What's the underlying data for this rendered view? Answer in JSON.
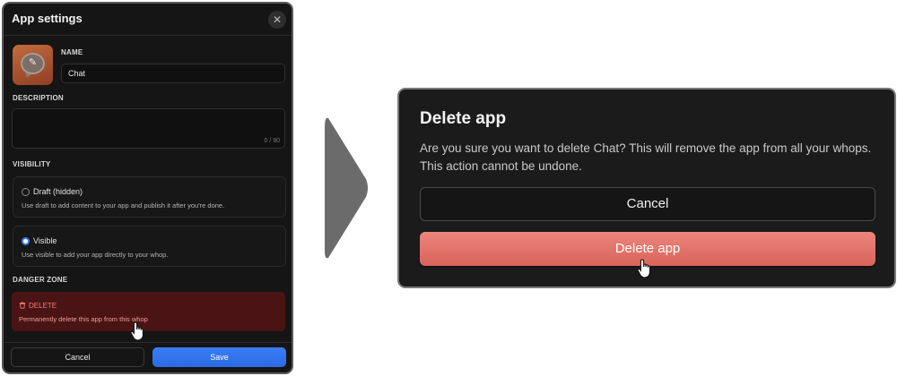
{
  "settings": {
    "title": "App settings",
    "close_glyph": "✕",
    "close_icon": "close-icon",
    "app_icon": "chat-bubble-icon",
    "edit_glyph": "✎",
    "name_label": "NAME",
    "name_value": "Chat",
    "description_label": "DESCRIPTION",
    "description_value": "",
    "char_count": "0 / 90",
    "visibility_label": "VISIBILITY",
    "options": [
      {
        "title": "Draft (hidden)",
        "description": "Use draft to add content to your app and publish it after you're done.",
        "checked": false
      },
      {
        "title": "Visible",
        "description": "Use visible to add your app directly to your whop.",
        "checked": true
      }
    ],
    "danger_label": "DANGER ZONE",
    "delete_label": "DELETE",
    "delete_icon": "trash-icon",
    "delete_description": "Permanently delete this app from this whop",
    "cancel_label": "Cancel",
    "save_label": "Save"
  },
  "dialog": {
    "title": "Delete app",
    "body": "Are you sure you want to delete Chat? This will remove the app from all your whops. This action cannot be undone.",
    "cancel_label": "Cancel",
    "delete_label": "Delete app"
  },
  "colors": {
    "panel_bg": "#151515",
    "danger_bg": "#4a1414",
    "danger_text": "#f07c7c",
    "primary_blue": "#2b6be6",
    "delete_red": "#d9645b",
    "arrow_gray": "#6b6b6b"
  }
}
